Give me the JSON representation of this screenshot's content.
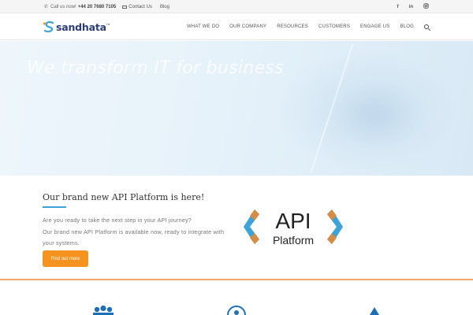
{
  "topbar": {
    "call_label": "Call us now!",
    "phone": "+44 20 7680 7105",
    "contact_label": "Contact Us",
    "blog_label": "Blog",
    "social": [
      "f",
      "in",
      "ig"
    ]
  },
  "header": {
    "logo_text": "sandhata",
    "logo_tm": "TM",
    "nav": [
      "WHAT WE DO",
      "OUR COMPANY",
      "RESOURCES",
      "CUSTOMERS",
      "ENGAGE US",
      "BLOG"
    ]
  },
  "hero": {
    "title": "We transform IT for business"
  },
  "api": {
    "title": "Our brand new API Platform is here!",
    "line1": "Are you ready to take the next step in your API journey?",
    "line2": "Our brand new API Platform is available now, ready to integrate with",
    "line3": "your systems.",
    "button_label": "Find out more",
    "logo_word1": "API",
    "logo_word2": "Platform"
  },
  "colors": {
    "accent_orange": "#f6921e",
    "accent_blue": "#3ba3d8",
    "logo_navy": "#2c3e75"
  },
  "icons": [
    "phone-icon",
    "mail-icon",
    "facebook-icon",
    "linkedin-icon",
    "instagram-icon",
    "search-icon",
    "team-icon",
    "globe-icon",
    "diamond-icon"
  ]
}
